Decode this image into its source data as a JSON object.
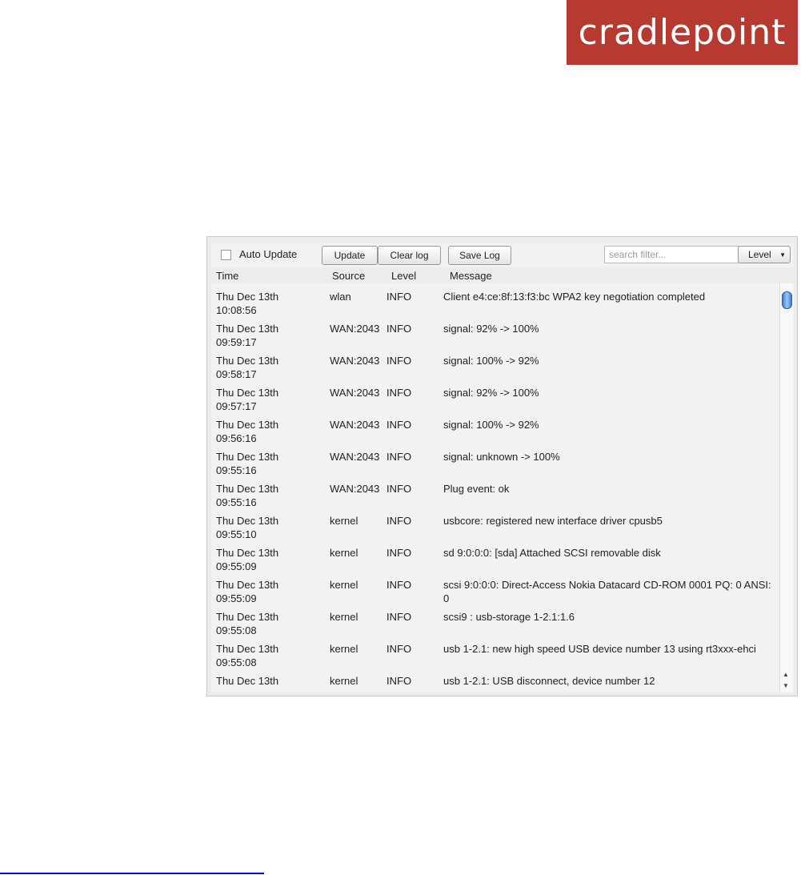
{
  "logo": {
    "text": "cradlepoint",
    "color": "#b73a30"
  },
  "toolbar": {
    "auto_update_label": "Auto Update",
    "auto_update_checked": false,
    "update": "Update",
    "clear_log": "Clear log",
    "save_log": "Save Log",
    "search_placeholder": "search filter...",
    "level_select": "Level"
  },
  "columns": [
    "Time",
    "Source",
    "Level",
    "Message"
  ],
  "rows": [
    {
      "date": "Thu Dec 13th",
      "time": "10:08:56",
      "source": "wlan",
      "level": "INFO",
      "message": "Client e4:ce:8f:13:f3:bc WPA2 key negotiation completed"
    },
    {
      "date": "Thu Dec 13th",
      "time": "09:59:17",
      "source": "WAN:2043",
      "level": "INFO",
      "message": "signal: 92% -> 100%"
    },
    {
      "date": "Thu Dec 13th",
      "time": "09:58:17",
      "source": "WAN:2043",
      "level": "INFO",
      "message": "signal: 100% -> 92%"
    },
    {
      "date": "Thu Dec 13th",
      "time": "09:57:17",
      "source": "WAN:2043",
      "level": "INFO",
      "message": "signal: 92% -> 100%"
    },
    {
      "date": "Thu Dec 13th",
      "time": "09:56:16",
      "source": "WAN:2043",
      "level": "INFO",
      "message": "signal: 100% -> 92%"
    },
    {
      "date": "Thu Dec 13th",
      "time": "09:55:16",
      "source": "WAN:2043",
      "level": "INFO",
      "message": "signal: unknown -> 100%"
    },
    {
      "date": "Thu Dec 13th",
      "time": "09:55:16",
      "source": "WAN:2043",
      "level": "INFO",
      "message": "Plug event: ok"
    },
    {
      "date": "Thu Dec 13th",
      "time": "09:55:10",
      "source": "kernel",
      "level": "INFO",
      "message": "usbcore: registered new interface driver cpusb5"
    },
    {
      "date": "Thu Dec 13th",
      "time": "09:55:09",
      "source": "kernel",
      "level": "INFO",
      "message": "sd 9:0:0:0: [sda] Attached SCSI removable disk"
    },
    {
      "date": "Thu Dec 13th",
      "time": "09:55:09",
      "source": "kernel",
      "level": "INFO",
      "message": "scsi 9:0:0:0: Direct-Access Nokia Datacard CD-ROM 0001 PQ: 0 ANSI: 0"
    },
    {
      "date": "Thu Dec 13th",
      "time": "09:55:08",
      "source": "kernel",
      "level": "INFO",
      "message": "scsi9 : usb-storage 1-2.1:1.6"
    },
    {
      "date": "Thu Dec 13th",
      "time": "09:55:08",
      "source": "kernel",
      "level": "INFO",
      "message": "usb 1-2.1: new high speed USB device number 13 using rt3xxx-ehci"
    },
    {
      "date": "Thu Dec 13th",
      "time": "",
      "source": "kernel",
      "level": "INFO",
      "message": "usb 1-2.1: USB disconnect, device number 12"
    }
  ]
}
